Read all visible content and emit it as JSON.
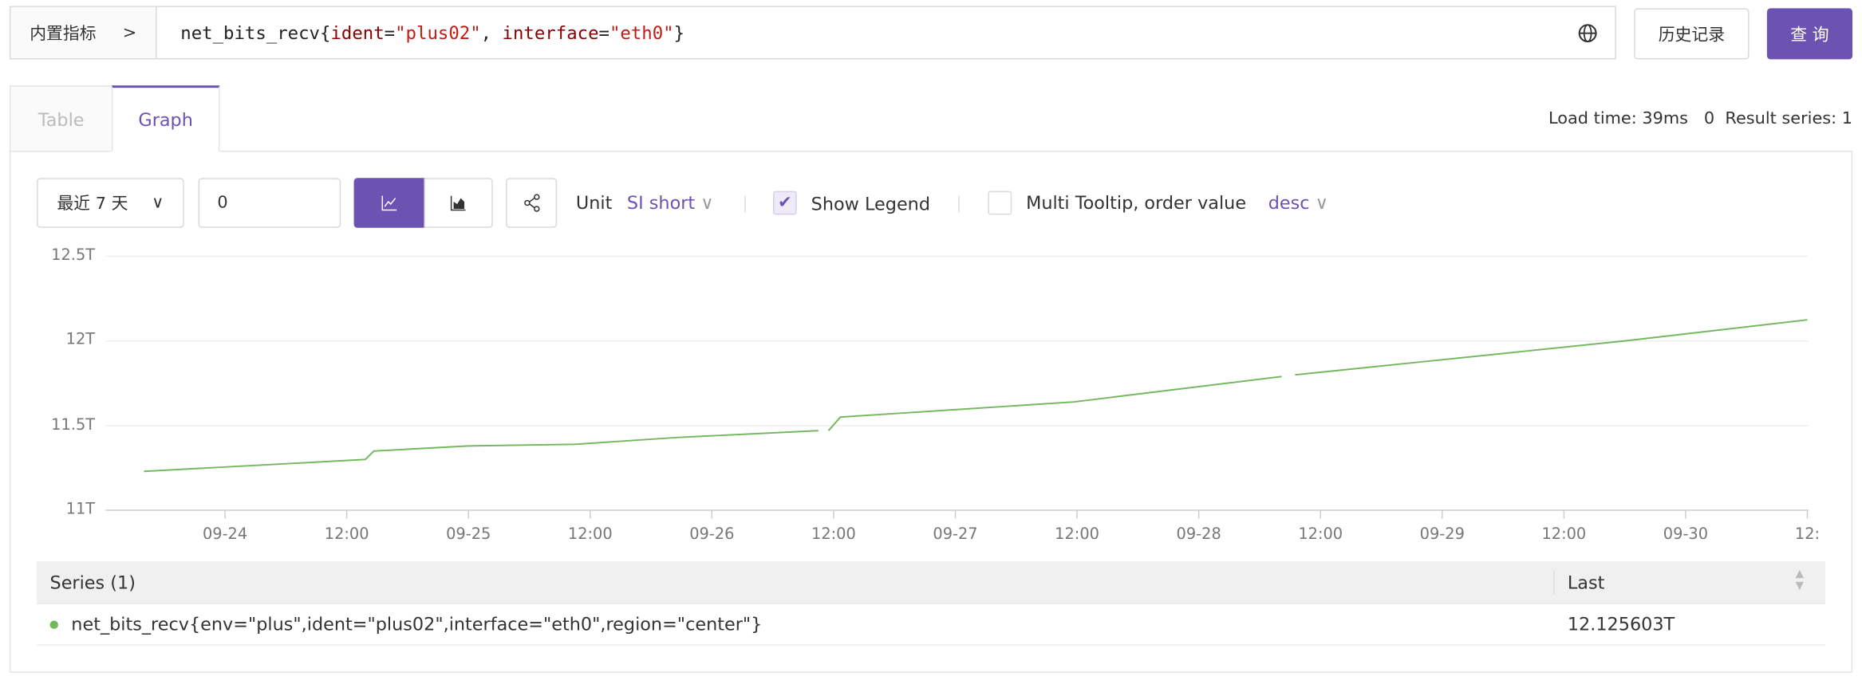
{
  "query": {
    "prefix": "内置指标",
    "metric": "net_bits_recv",
    "labels": [
      {
        "key": "ident",
        "value": "\"plus02\""
      },
      {
        "key": "interface",
        "value": "\"eth0\""
      }
    ],
    "history_label": "历史记录",
    "query_label": "查 询"
  },
  "tabs": [
    {
      "label": "Table",
      "active": false
    },
    {
      "label": "Graph",
      "active": true
    }
  ],
  "stats": "Load time: 39ms   0  Result series: 1",
  "toolbar": {
    "time_range": "最近 7 天",
    "step_value": "0",
    "unit_label": "Unit",
    "unit_value": "SI short",
    "show_legend_label": "Show Legend",
    "show_legend_checked": true,
    "multi_tooltip_label": "Multi Tooltip, order value",
    "multi_tooltip_checked": false,
    "order_value": "desc"
  },
  "colors": {
    "accent": "#6c53b1",
    "series": "#73b85f"
  },
  "chart_data": {
    "type": "line",
    "ylim": [
      11,
      12.5
    ],
    "yticks": [
      "12.5T",
      "12T",
      "11.5T",
      "11T"
    ],
    "xrange": [
      "09-23 12:00",
      "09-30 12:00"
    ],
    "xticks": [
      "09-24",
      "12:00",
      "09-25",
      "12:00",
      "09-26",
      "12:00",
      "09-27",
      "12:00",
      "09-28",
      "12:00",
      "09-29",
      "12:00",
      "09-30",
      "12:"
    ],
    "grid": true,
    "series": [
      {
        "name": "net_bits_recv{env=\"plus\",ident=\"plus02\",interface=\"eth0\",region=\"center\"}",
        "unit": "T",
        "points": [
          [
            "09-23 16:00",
            11.23
          ],
          [
            "09-24 13:50",
            11.3
          ],
          [
            "09-24 14:40",
            11.35
          ],
          [
            "09-25 00:00",
            11.38
          ],
          [
            "09-25 10:30",
            11.39
          ],
          [
            "09-25 20:30",
            11.43
          ],
          [
            "09-26 10:30",
            11.47
          ],
          null,
          [
            "09-26 11:30",
            11.47
          ],
          [
            "09-26 12:40",
            11.55
          ],
          [
            "09-27 11:40",
            11.64
          ],
          [
            "09-28 08:10",
            11.79
          ],
          null,
          [
            "09-28 09:30",
            11.8
          ],
          [
            "09-29 18:00",
            12.0
          ],
          [
            "09-30 12:00",
            12.125
          ]
        ]
      }
    ]
  },
  "legend": {
    "header_series": "Series (1)",
    "header_last": "Last",
    "rows": [
      {
        "name": "net_bits_recv{env=\"plus\",ident=\"plus02\",interface=\"eth0\",region=\"center\"}",
        "last": "12.125603T"
      }
    ]
  }
}
